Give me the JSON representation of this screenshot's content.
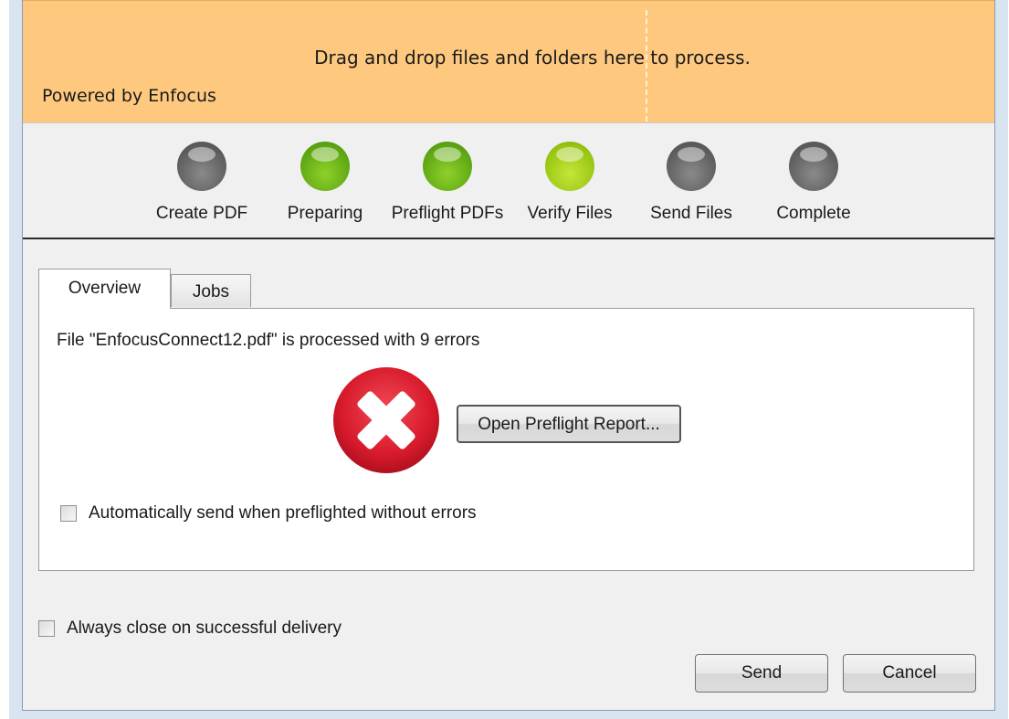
{
  "dropzone": {
    "message": "Drag and drop files and folders here to process.",
    "powered_by": "Powered by Enfocus"
  },
  "steps": [
    {
      "label": "Create PDF",
      "state": "inactive",
      "color": "#5b5b5b"
    },
    {
      "label": "Preparing",
      "state": "done",
      "color": "#5ba412"
    },
    {
      "label": "Preflight PDFs",
      "state": "done",
      "color": "#5ba412"
    },
    {
      "label": "Verify Files",
      "state": "active",
      "color": "#96c40f"
    },
    {
      "label": "Send Files",
      "state": "inactive",
      "color": "#5b5b5b"
    },
    {
      "label": "Complete",
      "state": "inactive",
      "color": "#5b5b5b"
    }
  ],
  "tabs": {
    "overview": "Overview",
    "jobs": "Jobs",
    "selected": "Overview"
  },
  "overview": {
    "status_message": "File \"EnfocusConnect12.pdf\" is processed with 9 errors",
    "status_icon": "error-icon",
    "open_report_label": "Open Preflight Report...",
    "auto_send_label": "Automatically send when preflighted without errors",
    "auto_send_checked": false
  },
  "footer": {
    "always_close_label": "Always close on successful delivery",
    "always_close_checked": false,
    "send_label": "Send",
    "cancel_label": "Cancel"
  },
  "colors": {
    "dropzone_bg": "#fec97f",
    "error_red": "#d81b2c"
  }
}
